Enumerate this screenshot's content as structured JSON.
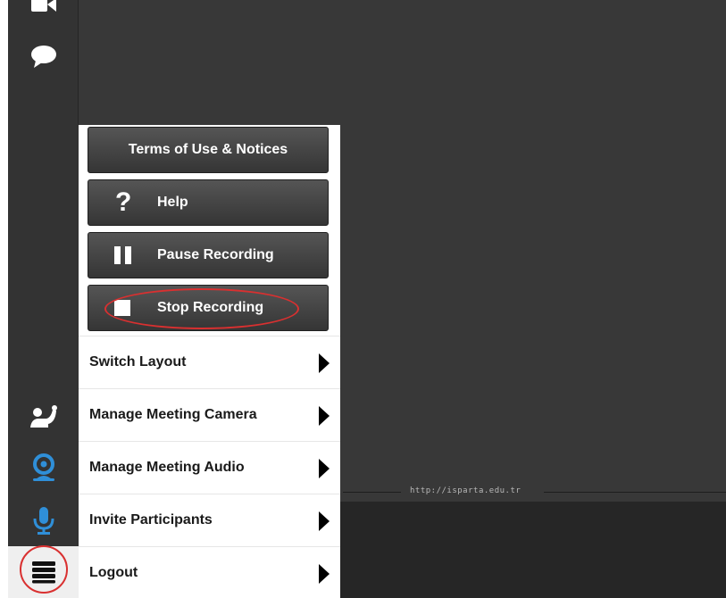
{
  "toolbar": {
    "icons": [
      "video-camera-icon",
      "chat-bubble-icon",
      "raise-hand-icon",
      "webcam-icon",
      "microphone-icon",
      "menu-icon"
    ]
  },
  "menu": {
    "buttons": [
      {
        "label": "Terms of Use & Notices",
        "icon": null
      },
      {
        "label": "Help",
        "icon": "question-icon"
      },
      {
        "label": "Pause Recording",
        "icon": "pause-icon"
      },
      {
        "label": "Stop Recording",
        "icon": "stop-icon"
      }
    ],
    "items": [
      {
        "label": "Switch Layout"
      },
      {
        "label": "Manage Meeting Camera"
      },
      {
        "label": "Manage Meeting Audio"
      },
      {
        "label": "Invite Participants"
      },
      {
        "label": "Logout"
      }
    ]
  },
  "watermark": {
    "text": "http://isparta.edu.tr"
  },
  "colors": {
    "accent": "#2f8fd8",
    "annotation": "#d93030",
    "panel": "#ffffff",
    "button": "#444444"
  }
}
